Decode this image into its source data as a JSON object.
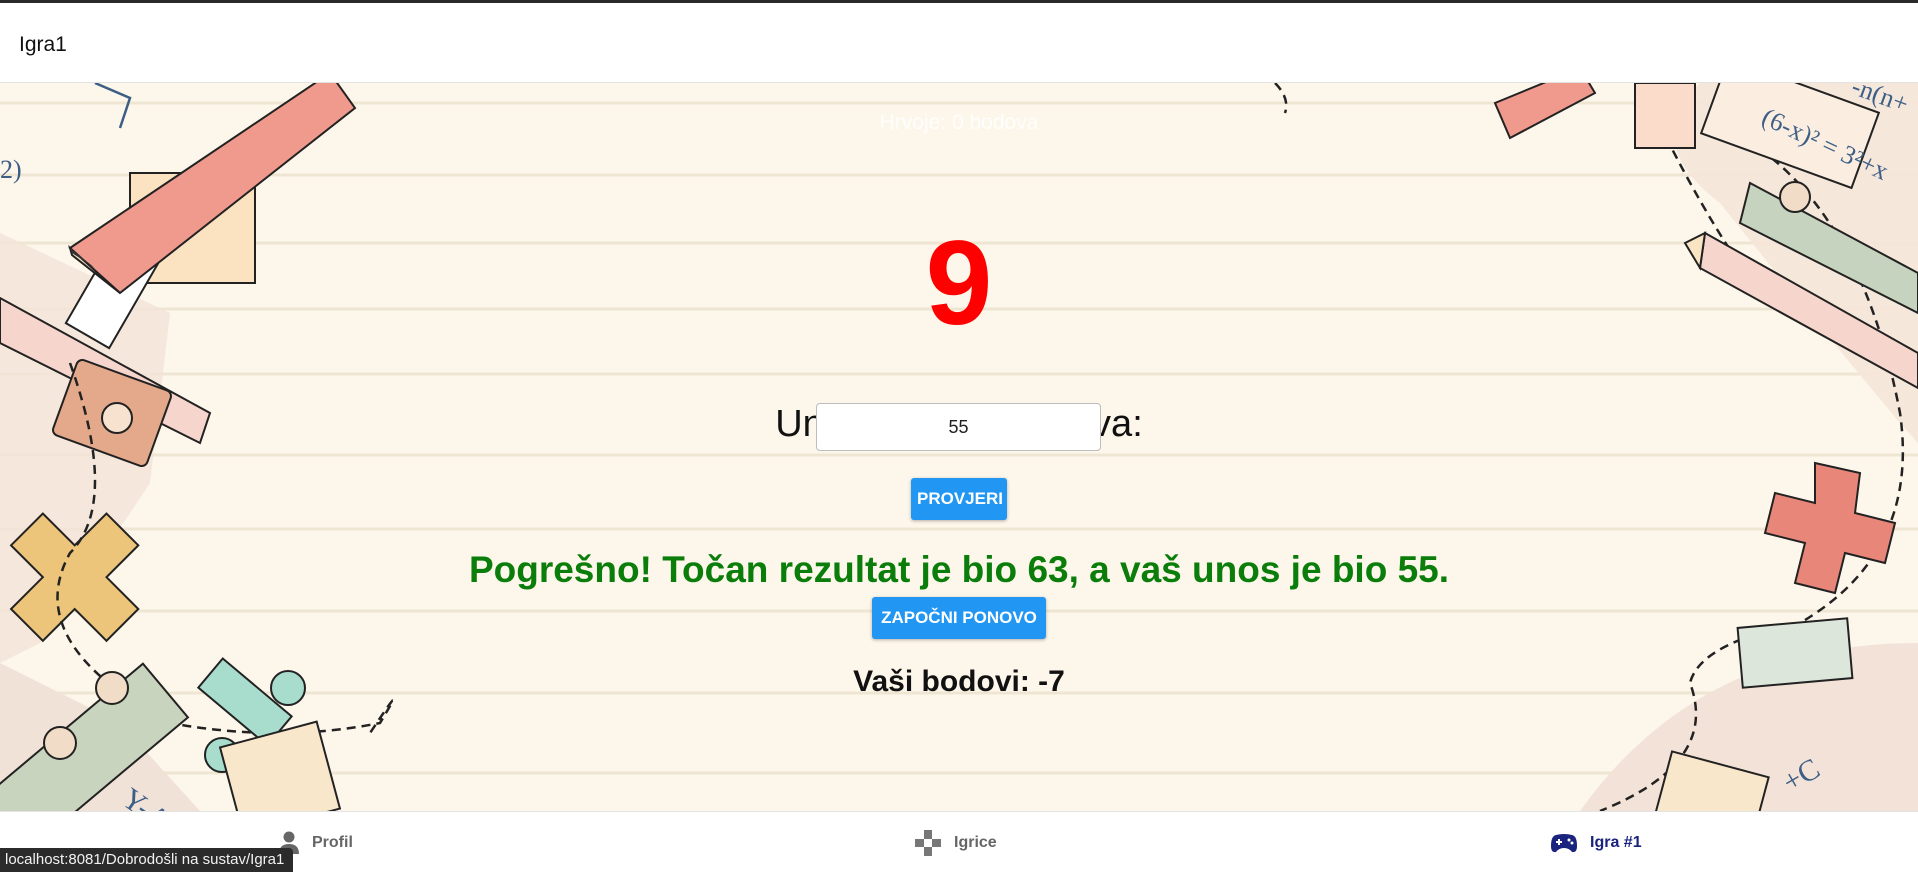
{
  "header": {
    "title": "Igra1"
  },
  "game": {
    "hint": "Hrvoje: 0 bodova",
    "number": "9",
    "prompt": "Unesite zbroj brojeva:",
    "input_value": "55",
    "check_button": "PROVJERI",
    "result": "Pogrešno! Točan rezultat je bio 63, a vaš unos je bio 55.",
    "restart_button": "ZAPOČNI PONOVO",
    "score": "Vaši bodovi: -7",
    "background_text": {
      "left": "2)",
      "right_top": "(6-x)² = 3²+x",
      "right_fragment": "-n(n+",
      "bottom_left": "Y-A",
      "bottom_right": "+C"
    }
  },
  "nav": {
    "items": [
      {
        "label": "Profil",
        "icon": "person-icon"
      },
      {
        "label": "Igrice",
        "icon": "gamepad-icon"
      },
      {
        "label": "Igra #1",
        "icon": "controller-icon",
        "active": true
      }
    ]
  },
  "status_bar": {
    "url": "localhost:8081/Dobrodošli na sustav/Igra1"
  },
  "colors": {
    "number": "#ff0000",
    "result": "#0a7d0a",
    "button": "#2196f3",
    "active_nav": "#1a237e",
    "background": "#fdf6ea"
  }
}
